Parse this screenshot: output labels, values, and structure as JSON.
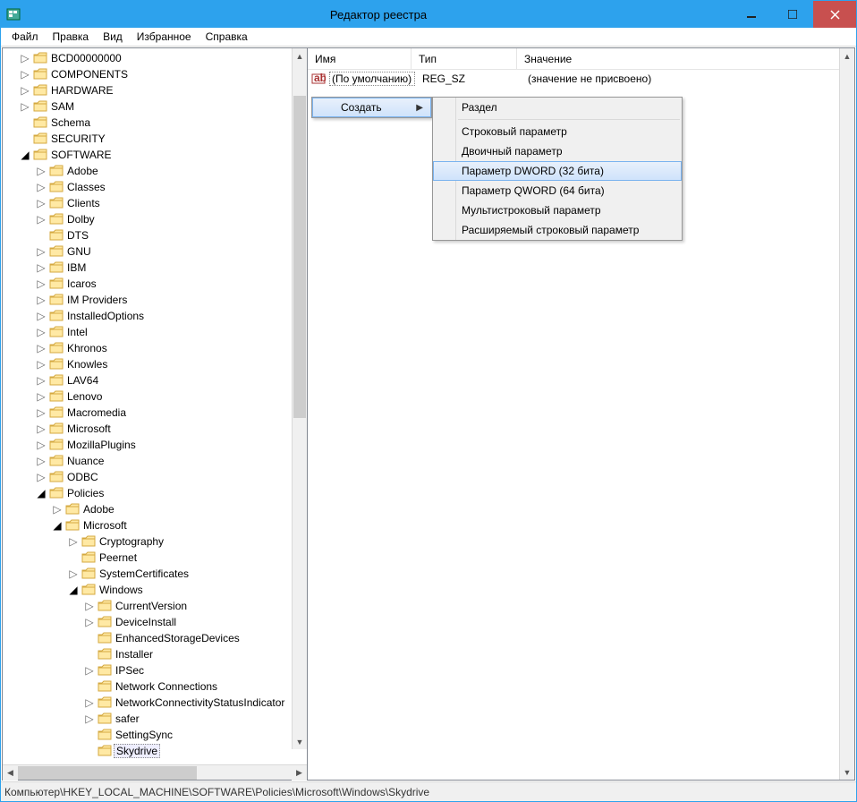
{
  "window": {
    "title": "Редактор реестра"
  },
  "menu": {
    "file": "Файл",
    "edit": "Правка",
    "view": "Вид",
    "favorites": "Избранное",
    "help": "Справка"
  },
  "tree": {
    "top": [
      {
        "l": "BCD00000000",
        "i": 1,
        "exp": "▷"
      },
      {
        "l": "COMPONENTS",
        "i": 1,
        "exp": "▷"
      },
      {
        "l": "HARDWARE",
        "i": 1,
        "exp": "▷"
      },
      {
        "l": "SAM",
        "i": 1,
        "exp": "▷"
      },
      {
        "l": "Schema",
        "i": 1,
        "exp": ""
      },
      {
        "l": "SECURITY",
        "i": 1,
        "exp": ""
      },
      {
        "l": "SOFTWARE",
        "i": 1,
        "exp": "◢",
        "open": true
      },
      {
        "l": "Adobe",
        "i": 2,
        "exp": "▷"
      },
      {
        "l": "Classes",
        "i": 2,
        "exp": "▷"
      },
      {
        "l": "Clients",
        "i": 2,
        "exp": "▷"
      },
      {
        "l": "Dolby",
        "i": 2,
        "exp": "▷"
      },
      {
        "l": "DTS",
        "i": 2,
        "exp": ""
      },
      {
        "l": "GNU",
        "i": 2,
        "exp": "▷"
      },
      {
        "l": "IBM",
        "i": 2,
        "exp": "▷"
      },
      {
        "l": "Icaros",
        "i": 2,
        "exp": "▷"
      },
      {
        "l": "IM Providers",
        "i": 2,
        "exp": "▷"
      },
      {
        "l": "InstalledOptions",
        "i": 2,
        "exp": "▷"
      },
      {
        "l": "Intel",
        "i": 2,
        "exp": "▷"
      },
      {
        "l": "Khronos",
        "i": 2,
        "exp": "▷"
      },
      {
        "l": "Knowles",
        "i": 2,
        "exp": "▷"
      },
      {
        "l": "LAV64",
        "i": 2,
        "exp": "▷"
      },
      {
        "l": "Lenovo",
        "i": 2,
        "exp": "▷"
      },
      {
        "l": "Macromedia",
        "i": 2,
        "exp": "▷"
      },
      {
        "l": "Microsoft",
        "i": 2,
        "exp": "▷"
      },
      {
        "l": "MozillaPlugins",
        "i": 2,
        "exp": "▷"
      },
      {
        "l": "Nuance",
        "i": 2,
        "exp": "▷"
      },
      {
        "l": "ODBC",
        "i": 2,
        "exp": "▷"
      },
      {
        "l": "Policies",
        "i": 2,
        "exp": "◢",
        "open": true
      },
      {
        "l": "Adobe",
        "i": 3,
        "exp": "▷"
      },
      {
        "l": "Microsoft",
        "i": 3,
        "exp": "◢",
        "open": true
      },
      {
        "l": "Cryptography",
        "i": 4,
        "exp": "▷"
      },
      {
        "l": "Peernet",
        "i": 4,
        "exp": ""
      },
      {
        "l": "SystemCertificates",
        "i": 4,
        "exp": "▷"
      },
      {
        "l": "Windows",
        "i": 4,
        "exp": "◢",
        "open": true
      },
      {
        "l": "CurrentVersion",
        "i": 5,
        "exp": "▷"
      },
      {
        "l": "DeviceInstall",
        "i": 5,
        "exp": "▷"
      },
      {
        "l": "EnhancedStorageDevices",
        "i": 5,
        "exp": ""
      },
      {
        "l": "Installer",
        "i": 5,
        "exp": ""
      },
      {
        "l": "IPSec",
        "i": 5,
        "exp": "▷"
      },
      {
        "l": "Network Connections",
        "i": 5,
        "exp": ""
      },
      {
        "l": "NetworkConnectivityStatusIndicator",
        "i": 5,
        "exp": "▷"
      },
      {
        "l": "safer",
        "i": 5,
        "exp": "▷"
      },
      {
        "l": "SettingSync",
        "i": 5,
        "exp": ""
      },
      {
        "l": "Skydrive",
        "i": 5,
        "exp": "",
        "selected": true
      }
    ]
  },
  "values": {
    "headers": {
      "name": "Имя",
      "type": "Тип",
      "value": "Значение"
    },
    "rows": [
      {
        "name": "(По умолчанию)",
        "type": "REG_SZ",
        "value": "(значение не присвоено)"
      }
    ]
  },
  "context": {
    "new": "Создать",
    "submenu": {
      "key": "Раздел",
      "string": "Строковый параметр",
      "binary": "Двоичный параметр",
      "dword": "Параметр DWORD (32 бита)",
      "qword": "Параметр QWORD (64 бита)",
      "multistring": "Мультистроковый параметр",
      "expandstring": "Расширяемый строковый параметр"
    }
  },
  "statusbar": "Компьютер\\HKEY_LOCAL_MACHINE\\SOFTWARE\\Policies\\Microsoft\\Windows\\Skydrive"
}
